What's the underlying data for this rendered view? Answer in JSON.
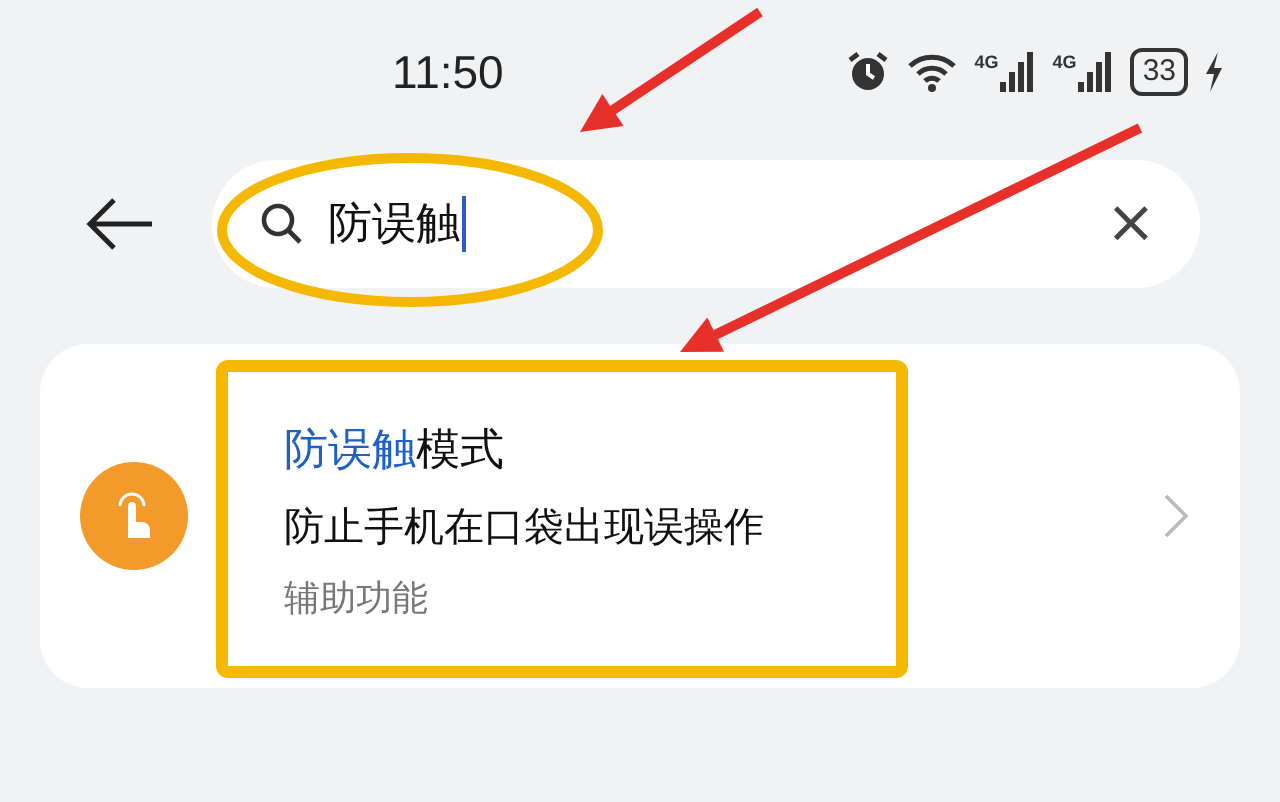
{
  "status_bar": {
    "time": "11:50",
    "networks": [
      {
        "label": "4G"
      },
      {
        "label": "4G"
      }
    ],
    "battery": "33",
    "charging": true
  },
  "search": {
    "value": "防误触",
    "clear_button": "×"
  },
  "results": [
    {
      "kind": "setting",
      "title": [
        {
          "text": "防误触",
          "highlighted": true
        },
        {
          "text": "模式",
          "highlighted": false
        }
      ],
      "description": "防止手机在口袋出现误操作",
      "category": "辅助功能"
    }
  ],
  "annotations": [
    {
      "kind": "ellipse",
      "color": "#f5b800"
    },
    {
      "kind": "rectangle",
      "color": "#f5b800"
    },
    {
      "kind": "arrow",
      "color": "#e8302a"
    },
    {
      "kind": "arrow",
      "color": "#e8302a"
    }
  ]
}
